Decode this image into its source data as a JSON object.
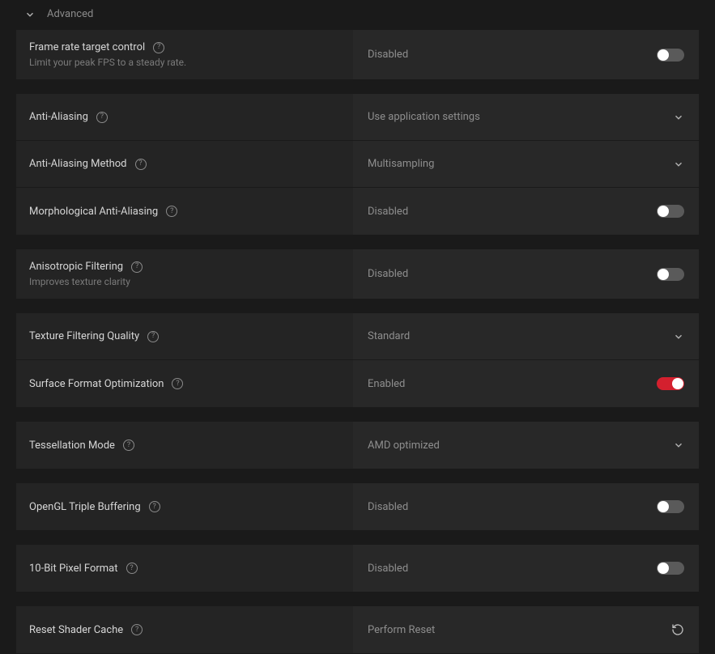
{
  "section": {
    "title": "Advanced"
  },
  "rows": {
    "frame_rate": {
      "label": "Frame rate target control",
      "subtext": "Limit your peak FPS to a steady rate.",
      "value": "Disabled"
    },
    "anti_aliasing": {
      "label": "Anti-Aliasing",
      "value": "Use application settings"
    },
    "aa_method": {
      "label": "Anti-Aliasing Method",
      "value": "Multisampling"
    },
    "morphological_aa": {
      "label": "Morphological Anti-Aliasing",
      "value": "Disabled"
    },
    "anisotropic": {
      "label": "Anisotropic Filtering",
      "subtext": "Improves texture clarity",
      "value": "Disabled"
    },
    "texture_filtering": {
      "label": "Texture Filtering Quality",
      "value": "Standard"
    },
    "surface_format": {
      "label": "Surface Format Optimization",
      "value": "Enabled"
    },
    "tessellation": {
      "label": "Tessellation Mode",
      "value": "AMD optimized"
    },
    "opengl_triple": {
      "label": "OpenGL Triple Buffering",
      "value": "Disabled"
    },
    "ten_bit": {
      "label": "10-Bit Pixel Format",
      "value": "Disabled"
    },
    "reset_shader": {
      "label": "Reset Shader Cache",
      "value": "Perform Reset"
    }
  }
}
